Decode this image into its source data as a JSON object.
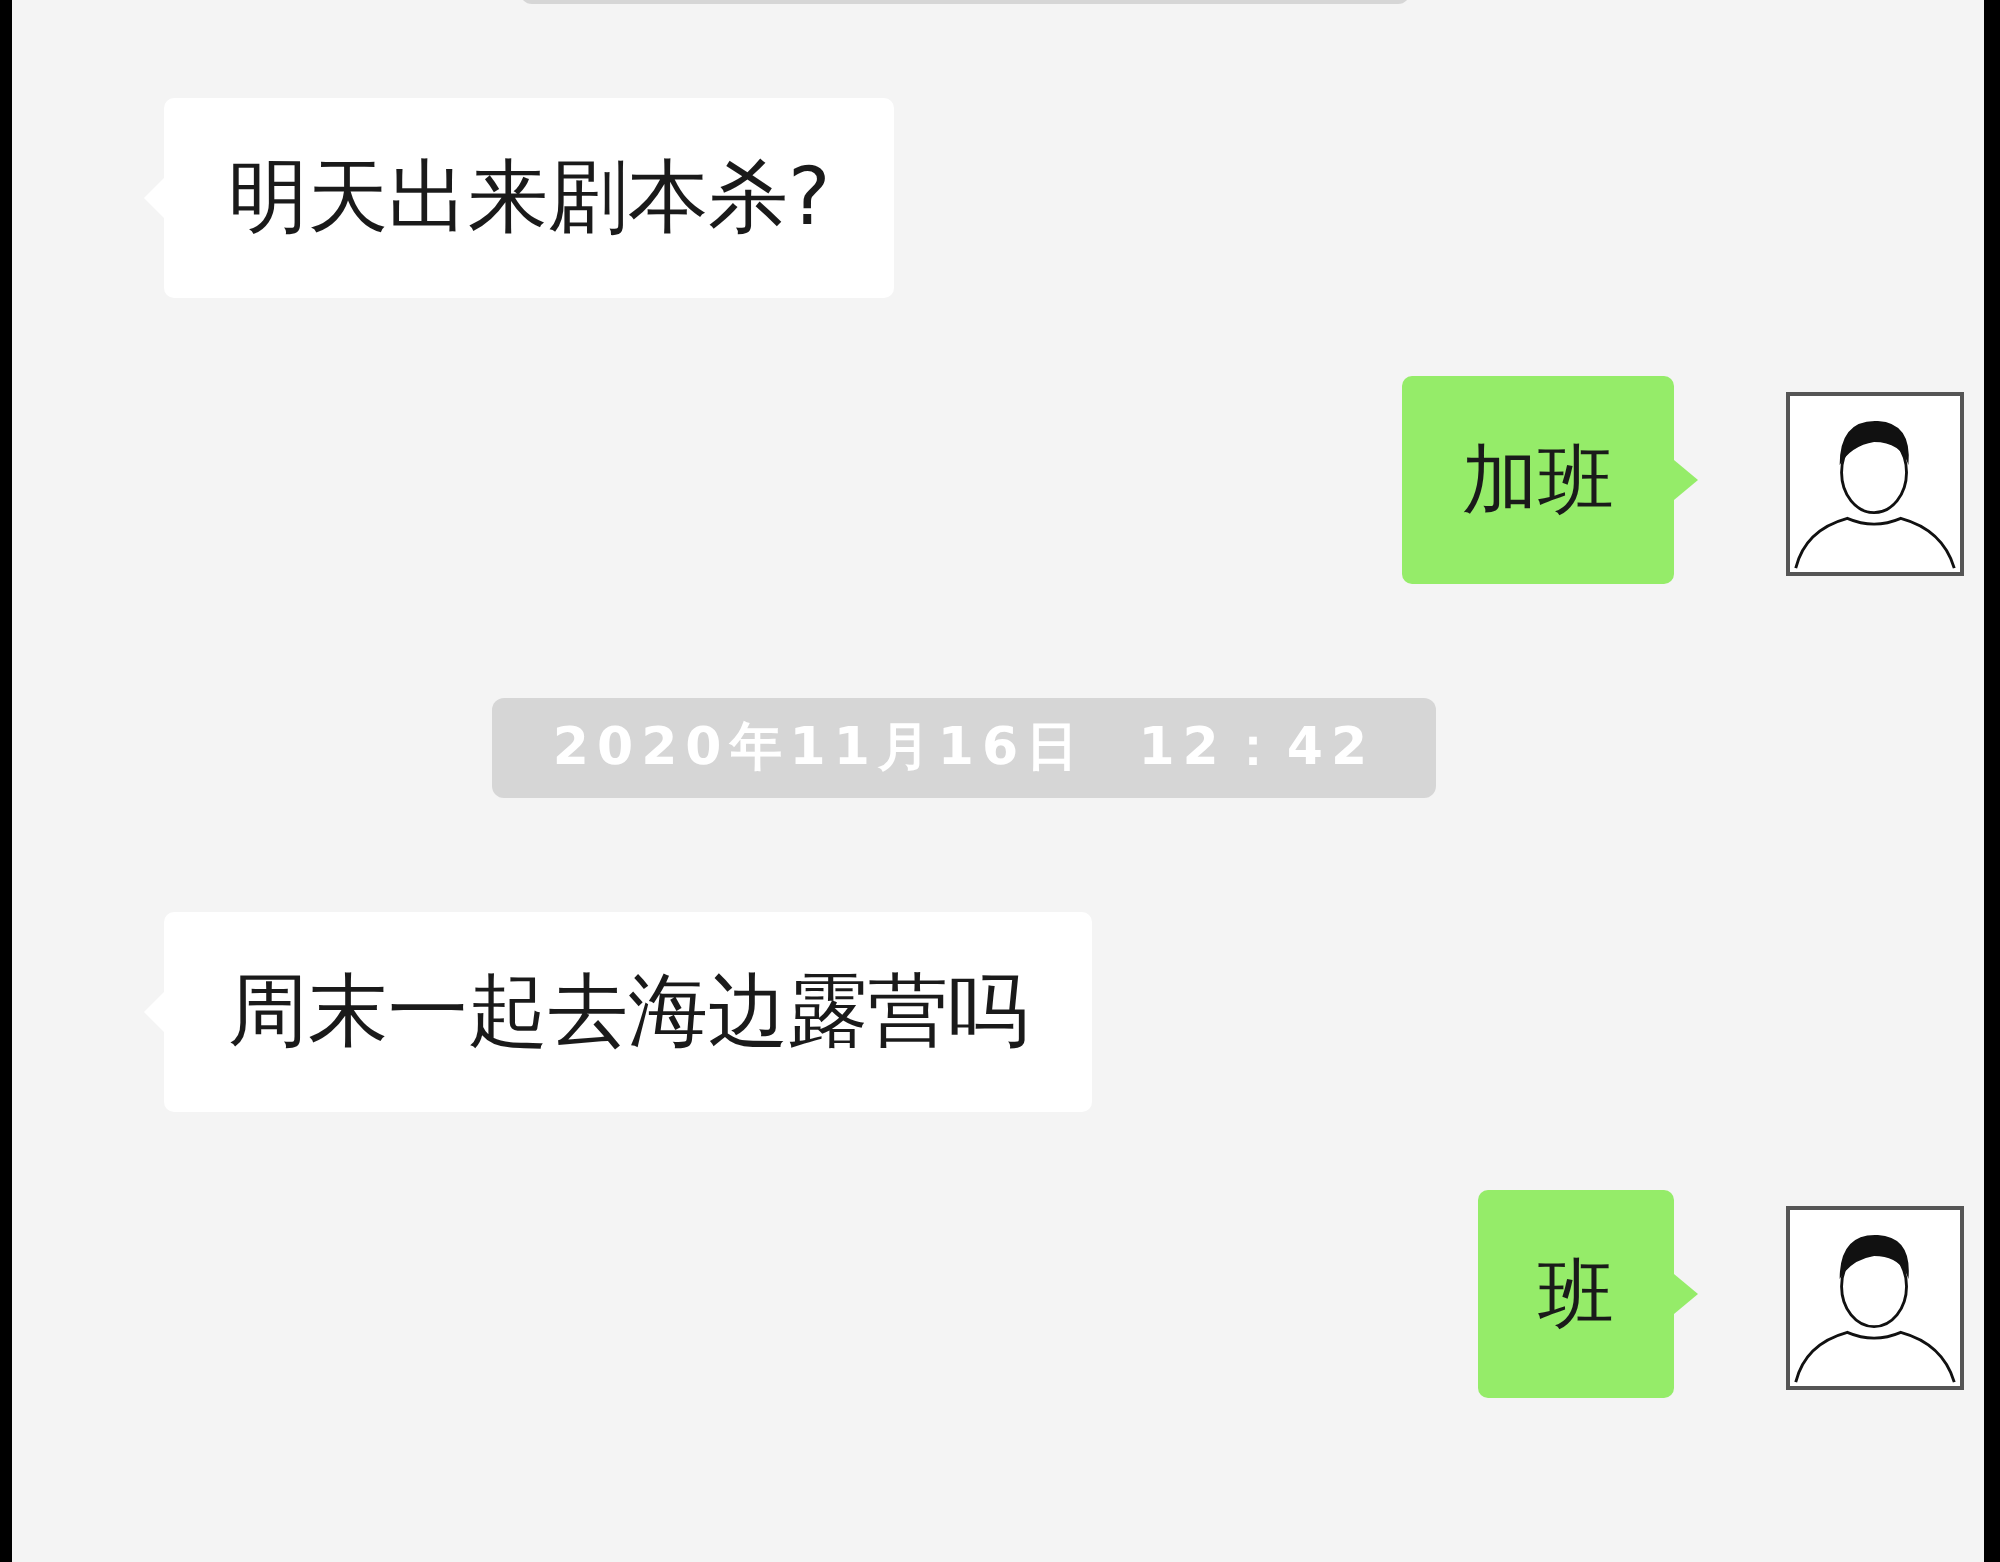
{
  "messages": [
    {
      "kind": "received",
      "text": "明天出来剧本杀?"
    },
    {
      "kind": "sent",
      "text": "加班"
    },
    {
      "kind": "time",
      "text": "2020年11月16日  12：42"
    },
    {
      "kind": "received",
      "text": "周末一起去海边露营吗"
    },
    {
      "kind": "sent",
      "text": "班"
    }
  ]
}
